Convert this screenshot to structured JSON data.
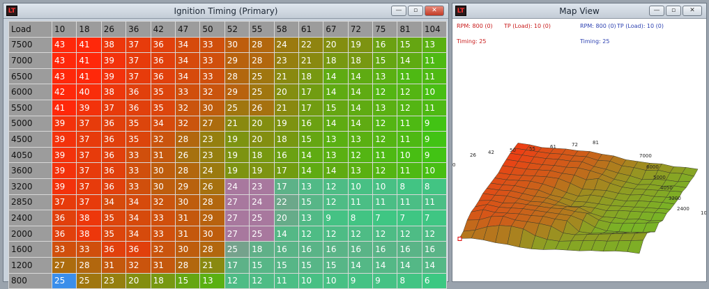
{
  "ignition_window": {
    "title": "Ignition Timing (Primary)",
    "app_icon": "lt-app-icon",
    "minimize_label": "—",
    "maximize_label": "▫",
    "close_label": "✕",
    "corner_label": "Load",
    "columns": [
      "10",
      "18",
      "26",
      "36",
      "42",
      "47",
      "50",
      "52",
      "55",
      "58",
      "61",
      "67",
      "72",
      "75",
      "81",
      "104"
    ],
    "rows": [
      {
        "load": "7500",
        "values": [
          43,
          41,
          38,
          37,
          36,
          34,
          33,
          30,
          28,
          24,
          22,
          20,
          19,
          16,
          15,
          13
        ]
      },
      {
        "load": "7000",
        "values": [
          43,
          41,
          39,
          37,
          36,
          34,
          33,
          29,
          28,
          23,
          21,
          18,
          18,
          15,
          14,
          11
        ]
      },
      {
        "load": "6500",
        "values": [
          43,
          41,
          39,
          37,
          36,
          34,
          33,
          28,
          25,
          21,
          18,
          14,
          14,
          13,
          11,
          11
        ]
      },
      {
        "load": "6000",
        "values": [
          42,
          40,
          38,
          36,
          35,
          33,
          32,
          29,
          25,
          20,
          17,
          14,
          14,
          12,
          12,
          10
        ]
      },
      {
        "load": "5500",
        "values": [
          41,
          39,
          37,
          36,
          35,
          32,
          30,
          25,
          26,
          21,
          17,
          15,
          14,
          13,
          12,
          11
        ]
      },
      {
        "load": "5000",
        "values": [
          39,
          37,
          36,
          35,
          34,
          32,
          27,
          21,
          20,
          19,
          16,
          14,
          14,
          12,
          11,
          9
        ]
      },
      {
        "load": "4500",
        "values": [
          39,
          37,
          36,
          35,
          32,
          28,
          23,
          19,
          20,
          18,
          15,
          13,
          13,
          12,
          11,
          9
        ]
      },
      {
        "load": "4050",
        "values": [
          39,
          37,
          36,
          33,
          31,
          26,
          23,
          19,
          18,
          16,
          14,
          13,
          12,
          11,
          10,
          9
        ]
      },
      {
        "load": "3600",
        "values": [
          39,
          37,
          36,
          33,
          30,
          28,
          24,
          19,
          19,
          17,
          14,
          14,
          13,
          12,
          11,
          10
        ]
      },
      {
        "load": "3200",
        "values": [
          39,
          37,
          36,
          33,
          30,
          29,
          26,
          24,
          23,
          17,
          13,
          12,
          10,
          10,
          8,
          8
        ]
      },
      {
        "load": "2850",
        "values": [
          37,
          37,
          34,
          34,
          32,
          30,
          28,
          27,
          24,
          22,
          15,
          12,
          11,
          11,
          11,
          11
        ]
      },
      {
        "load": "2400",
        "values": [
          36,
          38,
          35,
          34,
          33,
          31,
          29,
          27,
          25,
          20,
          13,
          9,
          8,
          7,
          7,
          7
        ]
      },
      {
        "load": "2000",
        "values": [
          36,
          38,
          35,
          34,
          33,
          31,
          30,
          27,
          25,
          14,
          12,
          12,
          12,
          12,
          12,
          12
        ]
      },
      {
        "load": "1600",
        "values": [
          33,
          33,
          36,
          36,
          32,
          30,
          28,
          25,
          18,
          16,
          16,
          16,
          16,
          16,
          16,
          16
        ]
      },
      {
        "load": "1200",
        "values": [
          27,
          28,
          31,
          32,
          31,
          28,
          21,
          17,
          15,
          15,
          15,
          15,
          14,
          14,
          14,
          14
        ]
      },
      {
        "load": "800",
        "values": [
          25,
          25,
          23,
          20,
          18,
          15,
          13,
          12,
          12,
          11,
          10,
          10,
          9,
          9,
          8,
          6
        ]
      }
    ],
    "selected": {
      "row": 15,
      "col": 0
    }
  },
  "map_window": {
    "title": "Map View",
    "cursor_primary": {
      "rpm": "RPM: 800 (0)",
      "load": "TP (Load): 10 (0)",
      "value": "Timing: 25"
    },
    "cursor_secondary": {
      "rpm": "RPM: 800 (0)",
      "load": "TP (Load): 10 (0)",
      "value": "Timing: 25"
    },
    "x_axis_labels": [
      "26",
      "42",
      "50",
      "55",
      "61",
      "72",
      "81"
    ],
    "y_axis_labels": [
      "7000",
      "6000",
      "5000",
      "4050",
      "3200",
      "2400"
    ],
    "axis_cut_labels": [
      "0",
      "10"
    ]
  }
}
